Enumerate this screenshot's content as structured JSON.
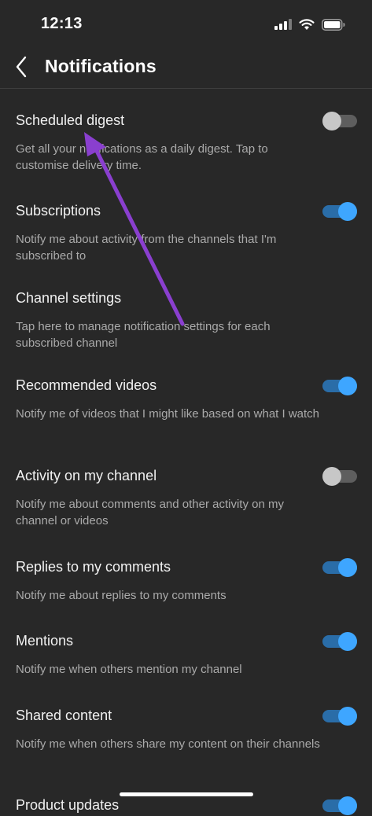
{
  "status_bar": {
    "time": "12:13"
  },
  "header": {
    "title": "Notifications"
  },
  "colors": {
    "background": "#282828",
    "toggle_on": "#3ea6ff",
    "annotation": "#8a3fcf"
  },
  "settings": [
    {
      "title": "Scheduled digest",
      "description": "Get all your notifications as a daily digest. Tap to customise delivery time.",
      "toggle": "off"
    },
    {
      "title": "Subscriptions",
      "description": "Notify me about activity from the channels that I'm subscribed to",
      "toggle": "on"
    },
    {
      "title": "Channel settings",
      "description": "Tap here to manage notification settings for each subscribed channel",
      "toggle": "none"
    },
    {
      "title": "Recommended videos",
      "description": "Notify me of videos that I might like based on what I watch",
      "toggle": "on"
    },
    {
      "title": "Activity on my channel",
      "description": "Notify me about comments and other activity on my channel or videos",
      "toggle": "off"
    },
    {
      "title": "Replies to my comments",
      "description": "Notify me about replies to my comments",
      "toggle": "on"
    },
    {
      "title": "Mentions",
      "description": "Notify me when others mention my channel",
      "toggle": "on"
    },
    {
      "title": "Shared content",
      "description": "Notify me when others share my content on their channels",
      "toggle": "on"
    },
    {
      "title": "Product updates",
      "description": "",
      "toggle": "on"
    }
  ]
}
